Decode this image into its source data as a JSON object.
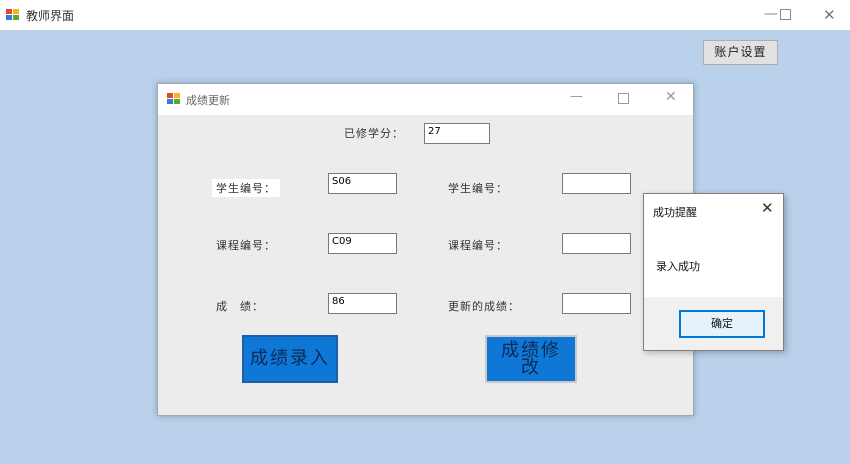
{
  "window": {
    "title": "教师界面",
    "minimize_glyph": "—",
    "close_glyph": "✕",
    "icon": "winforms-app-icon"
  },
  "account_button": "账户设置",
  "dialog": {
    "title": "成绩更新",
    "minimize_glyph": "—",
    "close_glyph": "✕",
    "credits_label": "已修学分：",
    "credits_value": "27",
    "left": {
      "student_id_label": "学生编号：",
      "student_id_value": "S06",
      "course_id_label": "课程编号：",
      "course_id_value": "C09",
      "score_label": "成　绩：",
      "score_value": "86"
    },
    "right": {
      "student_id_label": "学生编号：",
      "student_id_value": "",
      "course_id_label": "课程编号：",
      "course_id_value": "",
      "new_score_label": "更新的成绩：",
      "new_score_value": ""
    },
    "enter_button": "成绩录入",
    "modify_button_line1": "成绩修",
    "modify_button_line2": "改"
  },
  "message_box": {
    "title": "成功提醒",
    "close_glyph": "✕",
    "message": "录入成功",
    "ok_button": "确定"
  },
  "colors": {
    "background": "#b9d1ea",
    "button_blue": "#0f78d7",
    "focus_border": "#0078d7"
  }
}
